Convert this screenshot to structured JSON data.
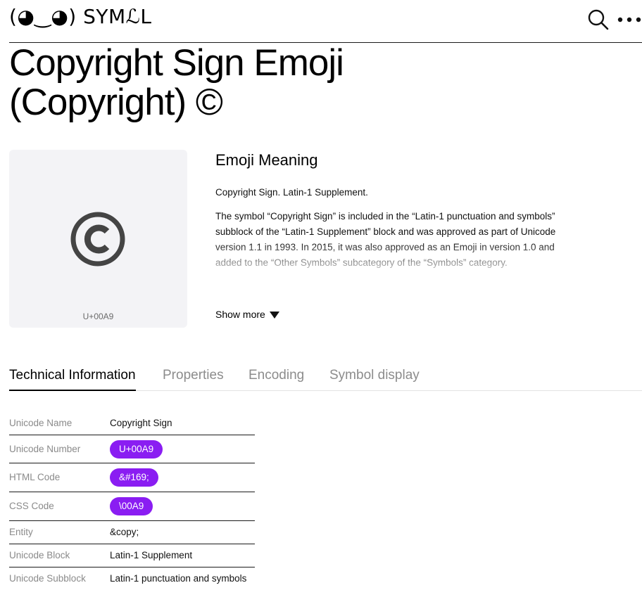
{
  "header": {
    "logo_text": "(◕‿◕) SYMℒL",
    "search_icon": "search-icon",
    "menu_icon": "more-horizontal-icon"
  },
  "page": {
    "title_line1": "Copyright Sign Emoji",
    "title_line2": "(Copyright) ©"
  },
  "preview": {
    "glyph_icon": "copyright-icon",
    "code": "U+00A9"
  },
  "meaning": {
    "heading": "Emoji Meaning",
    "short": "Copyright Sign. Latin-1 Supplement.",
    "long": "The symbol “Copyright Sign” is included in the “Latin-1 punctuation and symbols” subblock of the “Latin-1 Supplement” block and was approved as part of Unicode version 1.1 in 1993. In 2015, it was also approved as an Emoji in version 1.0 and added to the “Other Symbols” subcategory of the “Symbols” category.",
    "show_more": "Show more"
  },
  "tabs": [
    {
      "label": "Technical Information",
      "active": true
    },
    {
      "label": "Properties",
      "active": false
    },
    {
      "label": "Encoding",
      "active": false
    },
    {
      "label": "Symbol display",
      "active": false
    }
  ],
  "technical": {
    "rows": [
      {
        "label": "Unicode Name",
        "value": "Copyright Sign"
      },
      {
        "label": "Unicode Number",
        "value": "U+00A9"
      },
      {
        "label": "HTML Code",
        "value": "&#169;"
      },
      {
        "label": "CSS Code",
        "value": "\\00A9"
      },
      {
        "label": "Entity",
        "value": "&copy;"
      },
      {
        "label": "Unicode Block",
        "value": "Latin-1 Supplement"
      },
      {
        "label": "Unicode Subblock",
        "value": "Latin-1 punctuation and symbols"
      }
    ]
  },
  "colors": {
    "accent": "#8a1df2",
    "preview_bg": "#f3f3f6",
    "muted_text": "#8a8a8a"
  }
}
